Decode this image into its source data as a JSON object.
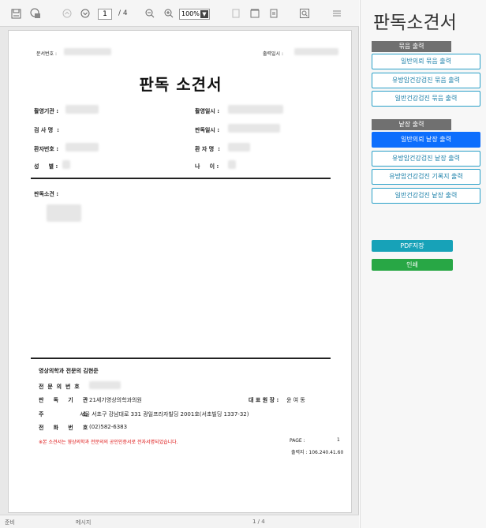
{
  "toolbar": {
    "page_number": "1",
    "page_total": "/ 4",
    "zoom": "100%"
  },
  "report": {
    "doc_no_label": "문서번호 :",
    "print_date_label": "출력일시 :",
    "title": "판독 소견서",
    "fields": {
      "institution": "촬영기관 :",
      "exam_date": "촬영일시 :",
      "exam_name": "검 사 명  :",
      "read_date": "판독일시 :",
      "patient_no": "환자번호 :",
      "patient_name": "환 자 명  :",
      "sex": "성     별 :",
      "age": "나     이 :"
    },
    "findings_label": "판독소견 :"
  },
  "footer": {
    "doctor": "영상의학과 전문의 김현준",
    "license_label": "전  문  의  번  호",
    "org_label": "판     독     기     관",
    "org_value": "21세기영상의학과의원",
    "ceo_label": "대 표 원 장 :",
    "ceo_value": "윤 여 동",
    "address_label": "주                    소",
    "address_value": "서울 서초구 강남대로 331 광일프라자빌딩 2001호(서초빌딩 1337-32)",
    "phone_label": "전     화     번     호",
    "phone_value": "(02)582-6383",
    "notice": "※본 소견서는 영상의학과 전문의의 공인인증서로 전자서명되었습니다.",
    "page_label": "PAGE :",
    "page_value": "1",
    "printer": "출력지 : 106.240.41.60"
  },
  "statusbar": {
    "left": "준비",
    "message": "메시지",
    "pages": "1 / 4"
  },
  "panel": {
    "title": "판독소견서",
    "bundle_header": "묶음 출력",
    "bundle_items": [
      "일반의뢰 묶음 출력",
      "유방암건강검진 묶음 출력",
      "일반건강검진 묶음 출력"
    ],
    "single_header": "낱장 출력",
    "single_items": [
      "일반의뢰 낱장 출력",
      "유방암건강검진 낱장 출력",
      "유방암건강검진 기록지 출력",
      "일반건강검진 낱장 출력"
    ],
    "pdf_label": "PDF저장",
    "print_label": "인쇄"
  },
  "colors": {
    "accent": "#0d6efd",
    "outline": "#2aa0c8",
    "pdf": "#17a2b8",
    "print": "#28a745",
    "notice": "#dd1111"
  }
}
